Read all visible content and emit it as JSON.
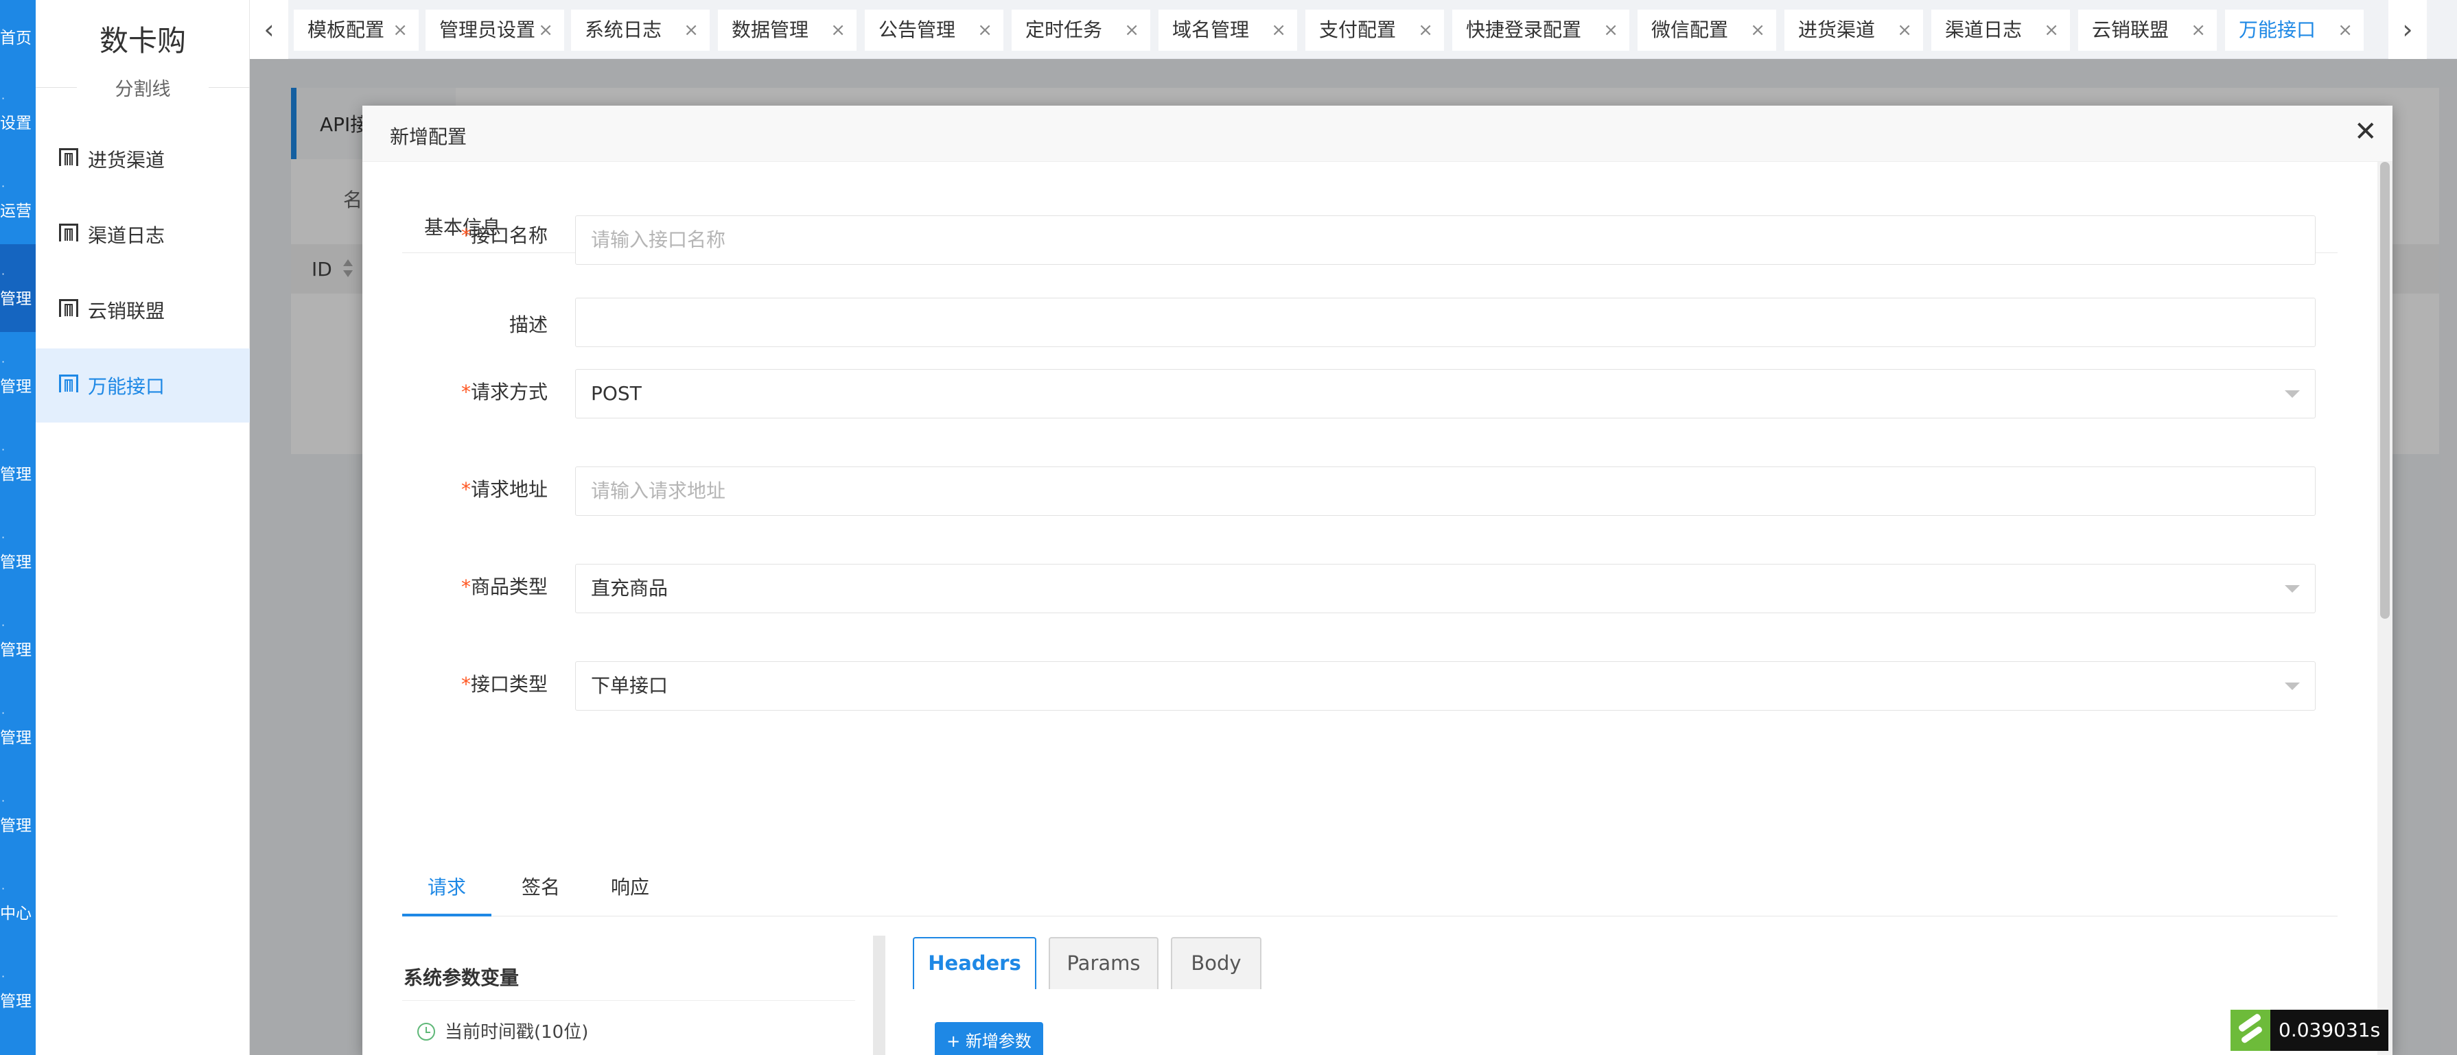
{
  "rail": {
    "items": [
      {
        "label": "首页",
        "glyph": "·"
      },
      {
        "label": "设置",
        "glyph": "·"
      },
      {
        "label": "运营",
        "glyph": "·"
      },
      {
        "label": "管理",
        "glyph": "·"
      },
      {
        "label": "管理",
        "glyph": "·"
      },
      {
        "label": "管理",
        "glyph": "·"
      },
      {
        "label": "管理",
        "glyph": "·"
      },
      {
        "label": "管理",
        "glyph": "·"
      },
      {
        "label": "管理",
        "glyph": "·"
      },
      {
        "label": "管理",
        "glyph": "·"
      },
      {
        "label": "中心",
        "glyph": "·"
      },
      {
        "label": "管理",
        "glyph": "·"
      }
    ]
  },
  "submenu": {
    "brand": "数卡购",
    "divider_label": "分割线",
    "items": [
      {
        "label": "进货渠道",
        "icon": "channel-icon"
      },
      {
        "label": "渠道日志",
        "icon": "channel-icon"
      },
      {
        "label": "云销联盟",
        "icon": "channel-icon"
      },
      {
        "label": "万能接口",
        "icon": "channel-icon"
      }
    ]
  },
  "tabs": {
    "prev_glyph": "‹",
    "next_glyph": "›",
    "close_glyph": "×",
    "items": [
      {
        "label": "模板配置"
      },
      {
        "label": "管理员设置"
      },
      {
        "label": "系统日志"
      },
      {
        "label": "数据管理"
      },
      {
        "label": "公告管理"
      },
      {
        "label": "定时任务"
      },
      {
        "label": "域名管理"
      },
      {
        "label": "支付配置"
      },
      {
        "label": "快捷登录配置"
      },
      {
        "label": "微信配置"
      },
      {
        "label": "进货渠道"
      },
      {
        "label": "渠道日志"
      },
      {
        "label": "云销联盟"
      },
      {
        "label": "万能接口"
      }
    ],
    "active_index": 13
  },
  "background": {
    "card_title": "API接",
    "search_label": "名",
    "table_header_id": "ID"
  },
  "modal": {
    "title": "新增配置",
    "close_glyph": "✕",
    "section_title": "基本信息",
    "required_mark": "*",
    "fields": {
      "name": {
        "label": "接口名称",
        "placeholder": "请输入接口名称"
      },
      "description": {
        "label": "描述",
        "value": ""
      },
      "method": {
        "label": "请求方式",
        "value": "POST"
      },
      "url": {
        "label": "请求地址",
        "placeholder": "请输入请求地址"
      },
      "product_type": {
        "label": "商品类型",
        "value": "直充商品"
      },
      "api_type": {
        "label": "接口类型",
        "value": "下单接口"
      }
    },
    "tabs": [
      {
        "label": "请求"
      },
      {
        "label": "签名"
      },
      {
        "label": "响应"
      }
    ],
    "variables": {
      "title": "系统参数变量",
      "items": [
        {
          "label": "当前时间戳(10位)"
        }
      ]
    },
    "subtabs": [
      {
        "label": "Headers"
      },
      {
        "label": "Params"
      },
      {
        "label": "Body"
      }
    ],
    "add_param_label": "+ 新增参数"
  },
  "timer": {
    "value": "0.039031s"
  },
  "colors": {
    "accent": "#1e88e5",
    "required": "#ff5722",
    "rail": "#1e88e5"
  }
}
